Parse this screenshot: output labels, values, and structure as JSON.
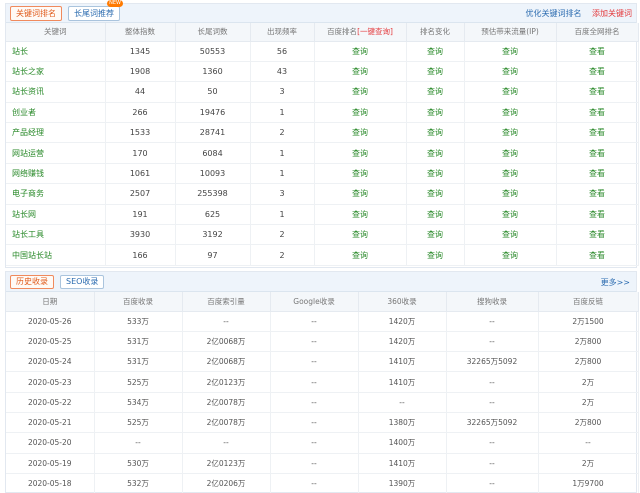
{
  "tabs": {
    "keyword_rank": "关键词排名",
    "longtail": "长尾词推荐",
    "new_badge": "NEW"
  },
  "links": {
    "optimize": "优化关键词排名",
    "add": "添加关键词"
  },
  "kw_headers": [
    "关键词",
    "整体指数",
    "长尾词数",
    "出现频率",
    "百度排名",
    "[一键查询]",
    "排名变化",
    "预估带来流量(IP)",
    "百度全网排名"
  ],
  "keywords": [
    {
      "kw": "站长",
      "index": "1345",
      "longtail": "50553",
      "freq": "56",
      "rank": "查询",
      "change": "查询",
      "flow": "查询",
      "all": "查看"
    },
    {
      "kw": "站长之家",
      "index": "1908",
      "longtail": "1360",
      "freq": "43",
      "rank": "查询",
      "change": "查询",
      "flow": "查询",
      "all": "查看"
    },
    {
      "kw": "站长资讯",
      "index": "44",
      "longtail": "50",
      "freq": "3",
      "rank": "查询",
      "change": "查询",
      "flow": "查询",
      "all": "查看"
    },
    {
      "kw": "创业者",
      "index": "266",
      "longtail": "19476",
      "freq": "1",
      "rank": "查询",
      "change": "查询",
      "flow": "查询",
      "all": "查看"
    },
    {
      "kw": "产品经理",
      "index": "1533",
      "longtail": "28741",
      "freq": "2",
      "rank": "查询",
      "change": "查询",
      "flow": "查询",
      "all": "查看"
    },
    {
      "kw": "网站运营",
      "index": "170",
      "longtail": "6084",
      "freq": "1",
      "rank": "查询",
      "change": "查询",
      "flow": "查询",
      "all": "查看"
    },
    {
      "kw": "网络赚钱",
      "index": "1061",
      "longtail": "10093",
      "freq": "1",
      "rank": "查询",
      "change": "查询",
      "flow": "查询",
      "all": "查看"
    },
    {
      "kw": "电子商务",
      "index": "2507",
      "longtail": "255398",
      "freq": "3",
      "rank": "查询",
      "change": "查询",
      "flow": "查询",
      "all": "查看"
    },
    {
      "kw": "站长网",
      "index": "191",
      "longtail": "625",
      "freq": "1",
      "rank": "查询",
      "change": "查询",
      "flow": "查询",
      "all": "查看"
    },
    {
      "kw": "站长工具",
      "index": "3930",
      "longtail": "3192",
      "freq": "2",
      "rank": "查询",
      "change": "查询",
      "flow": "查询",
      "all": "查看"
    },
    {
      "kw": "中国站长站",
      "index": "166",
      "longtail": "97",
      "freq": "2",
      "rank": "查询",
      "change": "查询",
      "flow": "查询",
      "all": "查看"
    }
  ],
  "history_tabs": {
    "history": "历史收录",
    "seo": "SEO收录",
    "more": "更多>>"
  },
  "hist_headers": [
    "日期",
    "百度收录",
    "百度索引量",
    "Google收录",
    "360收录",
    "搜狗收录",
    "百度反链"
  ],
  "history": [
    {
      "date": "2020-05-26",
      "baidu": "533万",
      "index": "--",
      "google": "--",
      "s360": "1420万",
      "sogou": "--",
      "backlink": "2万1500"
    },
    {
      "date": "2020-05-25",
      "baidu": "531万",
      "index": "2亿0068万",
      "google": "--",
      "s360": "1420万",
      "sogou": "--",
      "backlink": "2万800"
    },
    {
      "date": "2020-05-24",
      "baidu": "531万",
      "index": "2亿0068万",
      "google": "--",
      "s360": "1410万",
      "sogou": "32265万5092",
      "backlink": "2万800"
    },
    {
      "date": "2020-05-23",
      "baidu": "525万",
      "index": "2亿0123万",
      "google": "--",
      "s360": "1410万",
      "sogou": "--",
      "backlink": "2万"
    },
    {
      "date": "2020-05-22",
      "baidu": "534万",
      "index": "2亿0078万",
      "google": "--",
      "s360": "--",
      "sogou": "--",
      "backlink": "2万"
    },
    {
      "date": "2020-05-21",
      "baidu": "525万",
      "index": "2亿0078万",
      "google": "--",
      "s360": "1380万",
      "sogou": "32265万5092",
      "backlink": "2万800"
    },
    {
      "date": "2020-05-20",
      "baidu": "--",
      "index": "--",
      "google": "--",
      "s360": "1400万",
      "sogou": "--",
      "backlink": "--"
    },
    {
      "date": "2020-05-19",
      "baidu": "530万",
      "index": "2亿0123万",
      "google": "--",
      "s360": "1410万",
      "sogou": "--",
      "backlink": "2万"
    },
    {
      "date": "2020-05-18",
      "baidu": "532万",
      "index": "2亿0206万",
      "google": "--",
      "s360": "1390万",
      "sogou": "--",
      "backlink": "1万9700"
    }
  ]
}
